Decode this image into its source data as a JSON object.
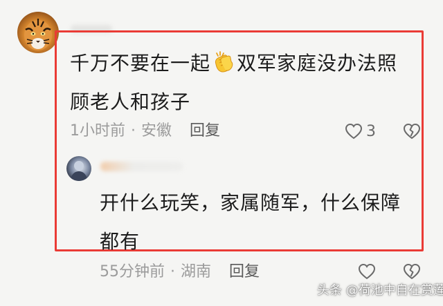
{
  "comment": {
    "text_before_emoji": "千万不要在一起",
    "emoji_icon": "clapping-hands-icon",
    "text_after_emoji": "双军家庭没办法照顾老人和孩子",
    "time": "1小时前",
    "dot": "·",
    "location": "安徽",
    "reply_label": "回复",
    "like_count": "3"
  },
  "reply": {
    "text": "开什么玩笑，家属随军，什么保障都有",
    "time": "55分钟前",
    "dot": "·",
    "location": "湖南",
    "reply_label": "回复"
  },
  "watermark": {
    "text": "头条 @荷池中自在赏莲"
  },
  "colors": {
    "highlight": "#ea3b35",
    "background": "#f5f5f3",
    "text": "#1c1c1c",
    "meta": "#9b9b9b"
  }
}
